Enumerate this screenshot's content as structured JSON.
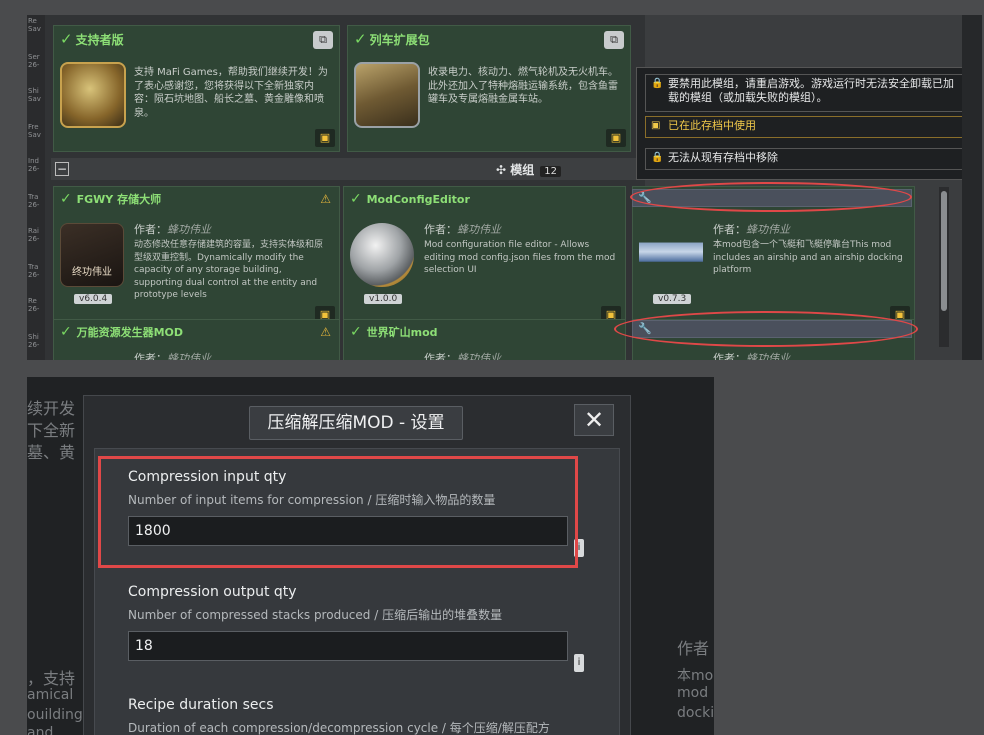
{
  "left_strip": {
    "items": [
      "Re",
      "Sav",
      "Ser",
      "26-",
      "Shi",
      "Sav",
      "Fre",
      "Sav",
      "Ind",
      "26-",
      "Tra",
      "26-",
      "Rai",
      "26-",
      "Tra",
      "26-",
      "Re",
      "26-",
      "Shi",
      "26-"
    ]
  },
  "dlc": {
    "supporter": {
      "title": "支持者版",
      "desc": "支持 MaFi Games，帮助我们继续开发！为了表心感谢您，您将获得以下全新独家内容：陨石坑地图、船长之墓、黄金雕像和喷泉。"
    },
    "train": {
      "title": "列车扩展包",
      "desc": "收录电力、核动力、燃气轮机及无火机车。此外还加入了特种熔融运输系统，包含鱼雷罐车及专属熔融金属车站。"
    }
  },
  "group": {
    "title": "模组",
    "count": "12"
  },
  "mods": [
    {
      "title": "FGWY 存储大师",
      "author_label": "作者：",
      "author": "蜂功伟业",
      "desc": "动态修改任意存储建筑的容量，支持实体级和原型级双重控制。Dynamically modify the capacity of any storage building, supporting dual control at the entity and prototype levels",
      "version": "v6.0.4",
      "thumb_label": "终功伟业"
    },
    {
      "title": "ModConfigEditor",
      "author_label": "作者：",
      "author": "蜂功伟业",
      "desc": "Mod configuration file editor - Allows editing mod config.json files from the mod selection UI",
      "version": "v1.0.0"
    },
    {
      "title": "",
      "author_label": "作者：",
      "author": "蜂功伟业",
      "desc": "本mod包含一个飞艇和飞艇停靠台This mod includes an airship and an airship docking platform",
      "version": "v0.7.3"
    },
    {
      "title": "万能资源发生器MOD",
      "author_label": "作者：",
      "author": "蜂功伟业"
    },
    {
      "title": "世界矿山mod",
      "author_label": "作者：",
      "author": "蜂功伟业"
    },
    {
      "author_label": "作者：",
      "author": "蜂功伟业"
    }
  ],
  "tooltip": {
    "line1": "要禁用此模组，请重启游戏。游戏运行时无法安全卸载已加载的模组（或加载失败的模组）。",
    "line2": "已在此存档中使用",
    "line3": "无法从现有存档中移除"
  },
  "bg_text": {
    "l1": "续开发",
    "l2": "下全新",
    "l3": "墓、黄",
    "l4": "，支持",
    "l5": "amical",
    "l6": "ouilding",
    "l7": "and",
    "r1": "作者",
    "r2": "本mo",
    "r3": "mod",
    "r4": "dockir"
  },
  "dialog": {
    "title": "压缩解压缩MOD - 设置",
    "close": "✕",
    "settings": [
      {
        "label": "Compression input qty",
        "help": "Number of input items for compression / 压缩时输入物品的数量",
        "value": "1800"
      },
      {
        "label": "Compression output qty",
        "help": "Number of compressed stacks produced / 压缩后输出的堆叠数量",
        "value": "18"
      },
      {
        "label": "Recipe duration secs",
        "help": "Duration of each compression/decompression cycle / 每个压缩/解压配方"
      }
    ]
  },
  "colors": {
    "accent_green": "#8ddf76",
    "highlight_red": "#e04848",
    "save_yellow": "#f2c23a"
  }
}
